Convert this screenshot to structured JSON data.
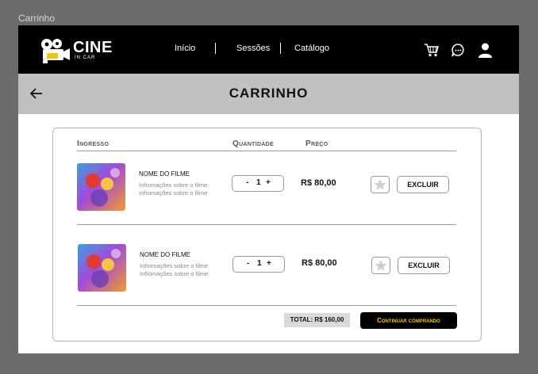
{
  "window": {
    "frame_label": "Carrinho"
  },
  "brand": {
    "name": "CINE",
    "tagline": "IN CAR"
  },
  "nav": {
    "links": [
      "Início",
      "Sessões",
      "Catálogo"
    ],
    "icons": [
      "cart-icon",
      "chat-icon",
      "user-icon"
    ]
  },
  "page": {
    "title": "CARRINHO"
  },
  "cart": {
    "headers": {
      "ticket": "Ingresso",
      "quantity": "Quantidade",
      "price": "Preço"
    },
    "items": [
      {
        "name": "NOME DO FILME",
        "info1": "Infromações sobre o filme",
        "info2": "Infromações sobre o filme",
        "minus": "-",
        "qty": "1",
        "plus": "+",
        "price": "R$ 80,00",
        "delete_label": "EXCLUIR"
      },
      {
        "name": "NOME DO FILME",
        "info1": "Infromações sobre o filme",
        "info2": "Infromações sobre o filme",
        "minus": "-",
        "qty": "1",
        "plus": "+",
        "price": "R$ 80,00",
        "delete_label": "EXCLUIR"
      }
    ],
    "total": "TOTAL: R$ 160,00",
    "continue_label": "Continuar comprando"
  },
  "colors": {
    "nav_bg": "#000000",
    "titlebar_bg": "#c1c1c1",
    "accent": "#f1c40f"
  }
}
